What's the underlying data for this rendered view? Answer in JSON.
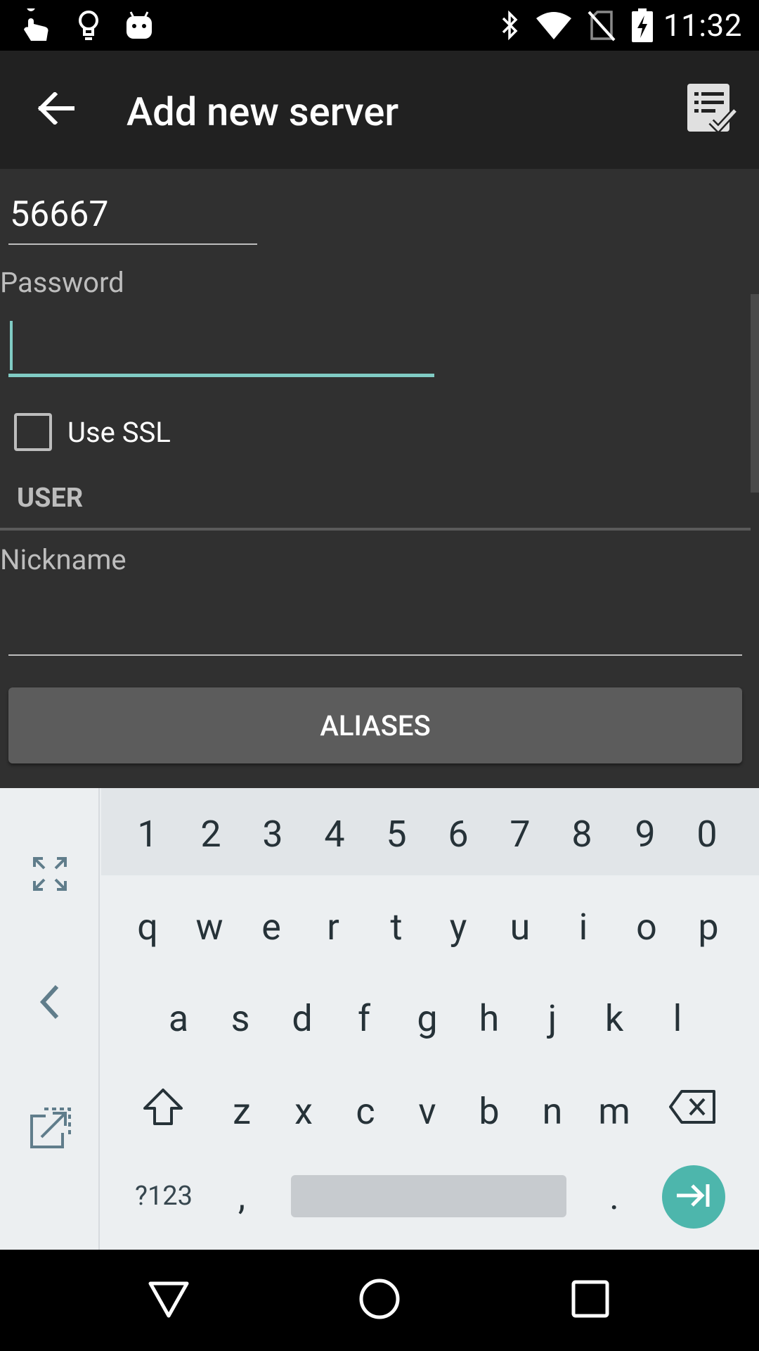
{
  "status_bar": {
    "time": "11:32",
    "left_icons": [
      "touch-app-icon",
      "lightbulb-icon",
      "android-icon"
    ],
    "right_icons": [
      "bluetooth-icon",
      "wifi-icon",
      "no-sim-icon",
      "battery-charging-icon"
    ]
  },
  "app_bar": {
    "title": "Add new server",
    "back_icon": "arrow-left-icon",
    "save_icon": "checklist-save-icon"
  },
  "form": {
    "port_value": "56667",
    "password_label": "Password",
    "password_value": "",
    "ssl_label": "Use SSL",
    "ssl_checked": false,
    "user_section_label": "USER",
    "nickname_label": "Nickname",
    "nickname_value": "",
    "aliases_button": "ALIASES"
  },
  "keyboard": {
    "number_row": [
      "1",
      "2",
      "3",
      "4",
      "5",
      "6",
      "7",
      "8",
      "9",
      "0"
    ],
    "row1": [
      "q",
      "w",
      "e",
      "r",
      "t",
      "y",
      "u",
      "i",
      "o",
      "p"
    ],
    "row2": [
      "a",
      "s",
      "d",
      "f",
      "g",
      "h",
      "j",
      "k",
      "l"
    ],
    "row3": [
      "z",
      "x",
      "c",
      "v",
      "b",
      "n",
      "m"
    ],
    "symbols_key": "?123",
    "comma_key": ",",
    "period_key": ".",
    "side_icons": [
      "fullscreen-icon",
      "chevron-left-icon",
      "open-external-icon"
    ],
    "shift_icon": "shift-icon",
    "backspace_icon": "backspace-icon",
    "enter_icon": "tab-next-icon",
    "accent_color": "#4db6ac"
  },
  "nav_bar": {
    "icons": [
      "back-triangle-icon",
      "home-circle-icon",
      "recents-square-icon"
    ]
  },
  "colors": {
    "background": "#303030",
    "app_bar": "#212121",
    "focus_accent": "#80cbc4",
    "button": "#5c5c5c"
  }
}
